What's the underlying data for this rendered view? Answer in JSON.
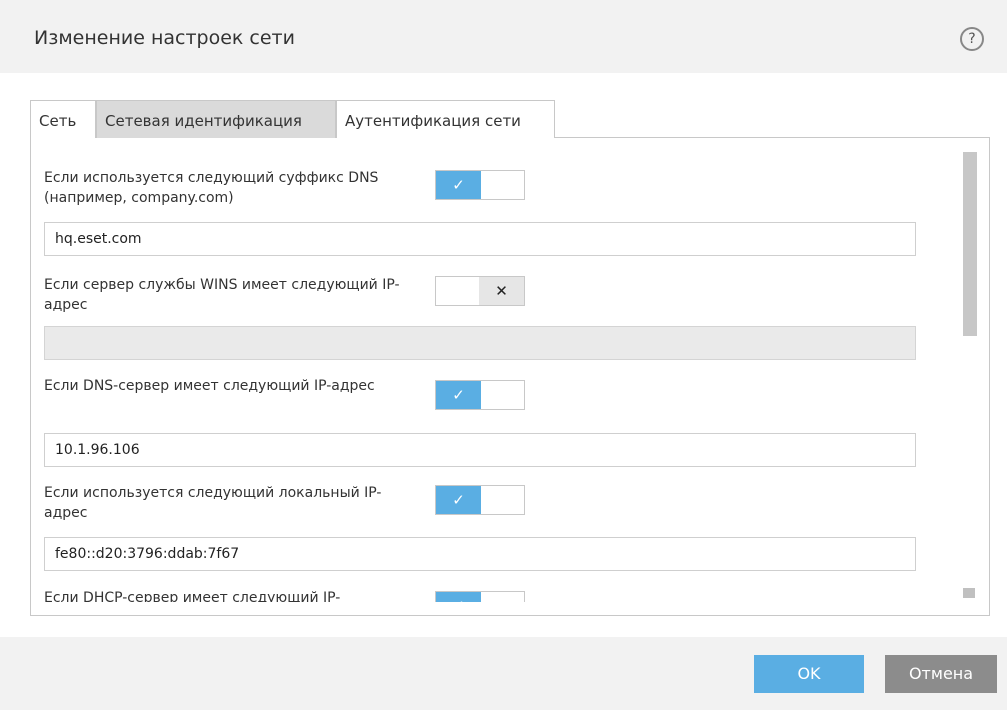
{
  "dialog": {
    "title": "Изменение настроек сети",
    "help_label": "?"
  },
  "tabs": [
    {
      "label": "Сеть"
    },
    {
      "label": "Сетевая идентификация"
    },
    {
      "label": "Аутентификация сети"
    }
  ],
  "rules": [
    {
      "label": "Если используется следующий суффикс DNS (например, company.com)",
      "enabled": true,
      "value": "hq.eset.com"
    },
    {
      "label": "Если сервер службы WINS имеет следующий IP-адрес",
      "enabled": false,
      "value": ""
    },
    {
      "label": "Если DNS-сервер имеет следующий IP-адрес",
      "enabled": true,
      "value": "10.1.96.106"
    },
    {
      "label": "Если используется следующий локальный IP-адрес",
      "enabled": true,
      "value": "fe80::d20:3796:ddab:7f67"
    },
    {
      "label": "Если DHCP-сервер имеет следующий IP-",
      "enabled": true
    }
  ],
  "toggle_icons": {
    "on": "✓",
    "off": "✕"
  },
  "buttons": {
    "ok": "OK",
    "cancel": "Отмена"
  },
  "colors": {
    "accent": "#5aaee3",
    "cancel": "#8c8c8c"
  }
}
